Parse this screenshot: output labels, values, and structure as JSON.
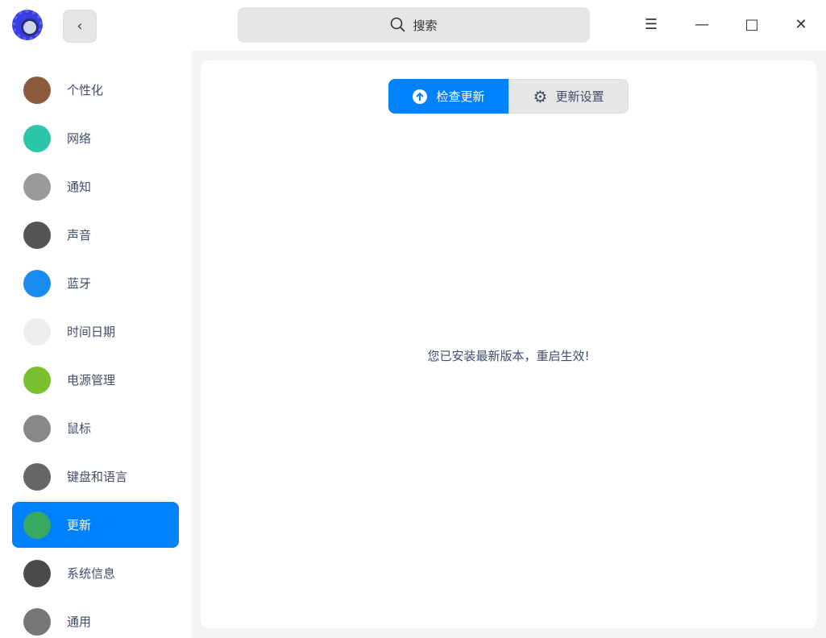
{
  "header": {
    "search_placeholder": "搜索",
    "back_icon": "chevron-left",
    "menu_icon": "menu",
    "minimize_icon": "minimize",
    "maximize_icon": "maximize",
    "close_icon": "close"
  },
  "sidebar": {
    "items": [
      {
        "label": "个性化",
        "color": "#8a5a3a"
      },
      {
        "label": "网络",
        "color": "#2cc6a8"
      },
      {
        "label": "通知",
        "color": "#9a9a9a"
      },
      {
        "label": "声音",
        "color": "#555555"
      },
      {
        "label": "蓝牙",
        "color": "#1a8cf0"
      },
      {
        "label": "时间日期",
        "color": "#eeeeee"
      },
      {
        "label": "电源管理",
        "color": "#7ac030"
      },
      {
        "label": "鼠标",
        "color": "#888888"
      },
      {
        "label": "键盘和语言",
        "color": "#666666"
      },
      {
        "label": "更新",
        "color": "#3aa860",
        "active": true
      },
      {
        "label": "系统信息",
        "color": "#4a4a4a"
      },
      {
        "label": "通用",
        "color": "#777777"
      }
    ]
  },
  "main": {
    "tabs": [
      {
        "label": "检查更新",
        "active": true
      },
      {
        "label": "更新设置",
        "active": false
      }
    ],
    "status_message": "您已安装最新版本，重启生效!"
  },
  "colors": {
    "accent": "#0081ff"
  }
}
